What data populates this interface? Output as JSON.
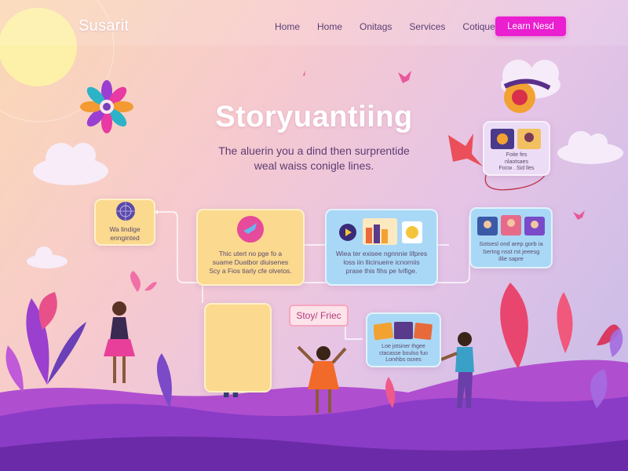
{
  "nav": {
    "logo": "Susarit",
    "links": [
      "Home",
      "Home",
      "Onitags",
      "Services",
      "Cotique"
    ],
    "cta": "Learn Nesd"
  },
  "hero": {
    "title": "Storyuantiing",
    "subtitle_line1": "The aluerin you a dind then surprentide",
    "subtitle_line2": "weal waiss conigle lines."
  },
  "cards": {
    "left_small": {
      "line1": "Wa lindige",
      "line2": "ennginted"
    },
    "yellow_1": {
      "line1": "Thic utert no pge fo a",
      "line2": "suame Duatbor diuisenes",
      "line3": "Scy a Fios tiarly cfe olvetos."
    },
    "blue_1": {
      "line1": "Wiea ter exisee ngnnnie lifpres",
      "line2": "loss iin llicinueire icnorniis",
      "line3": "prase this fihs pe lvifige."
    },
    "right_small": {
      "line1": "Sotsesl ond arep gorb ia",
      "line2": "Sertng nsst rst jeeesg",
      "line3": "illie sapre"
    },
    "top_right": {
      "line1": "Foite fes",
      "line2": "nlaotsaes",
      "line3": "Focw . Sid lles"
    },
    "story_tag": "Stoy/ Friec",
    "blue_2": {
      "line1": "Loe jotsiner thgee",
      "line2": "ctacasse boulso fuo",
      "line3": "Lorxhbs osnes"
    }
  },
  "colors": {
    "accent": "#ea1fd0",
    "yellow_card": "#fbd98e",
    "blue_card": "#a9d8f6",
    "purple_ground": "#8a3cc7"
  }
}
